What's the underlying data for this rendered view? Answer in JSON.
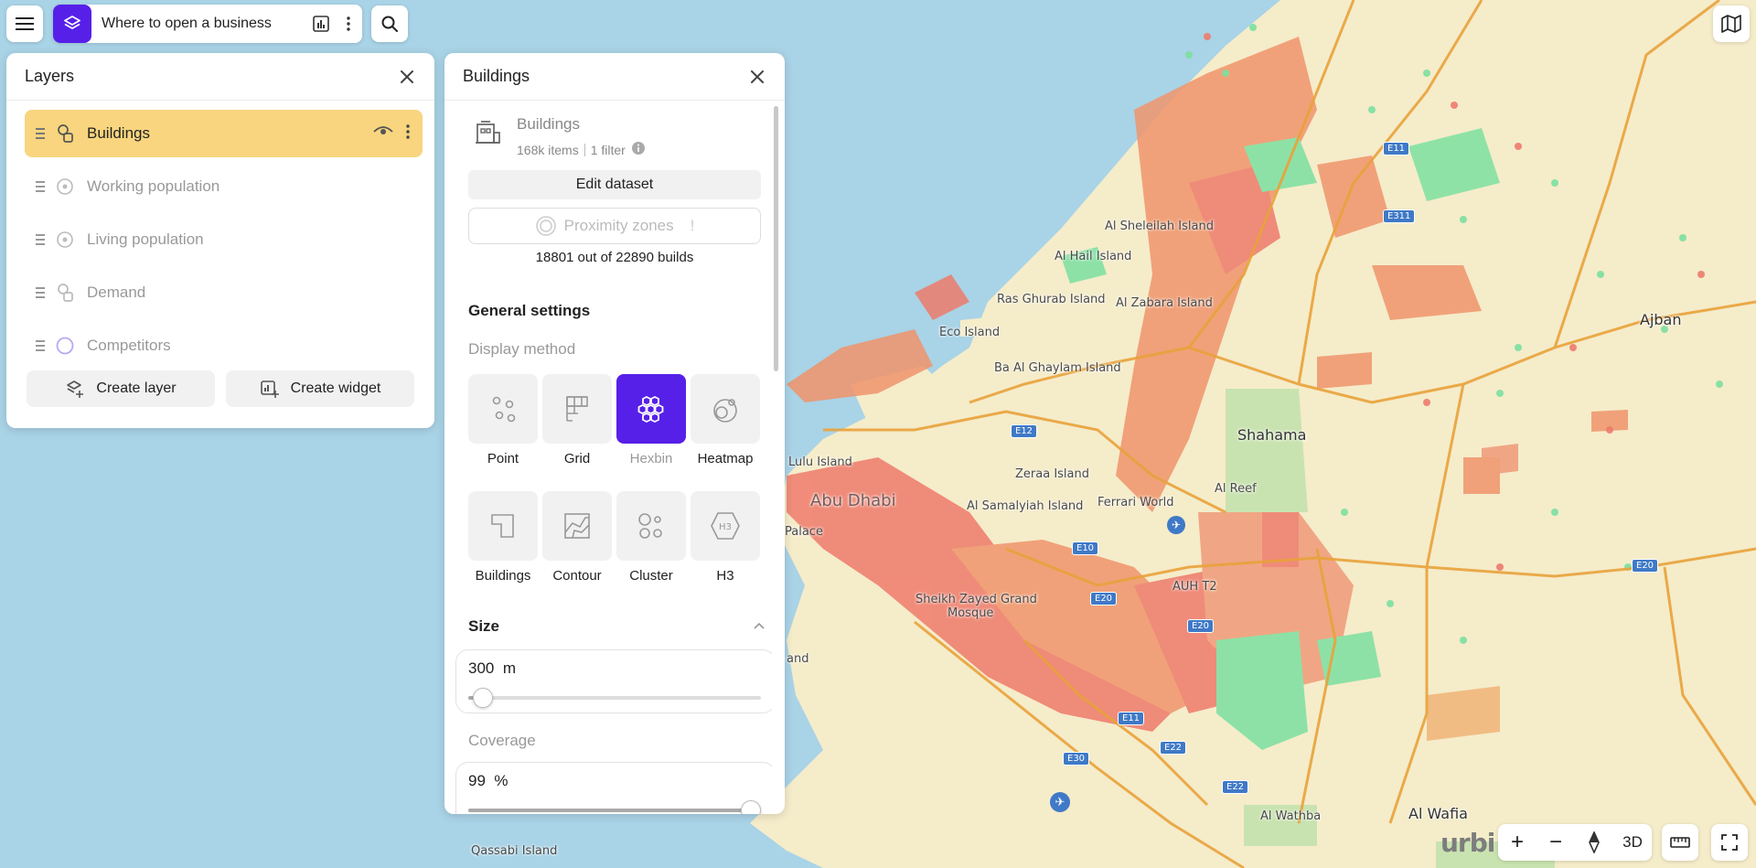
{
  "project": {
    "title": "Where to open a business"
  },
  "layers_panel": {
    "title": "Layers",
    "layers": [
      {
        "name": "Buildings",
        "active": true
      },
      {
        "name": "Working population",
        "active": false
      },
      {
        "name": "Living population",
        "active": false
      },
      {
        "name": "Demand",
        "active": false
      },
      {
        "name": "Competitors",
        "active": false
      }
    ],
    "create_layer_label": "Create layer",
    "create_widget_label": "Create widget"
  },
  "buildings_panel": {
    "title": "Buildings",
    "dataset_name": "Buildings",
    "items_count": "168k items",
    "filter_count": "1 filter",
    "edit_dataset_label": "Edit dataset",
    "proximity_zones_label": "Proximity zones",
    "proximity_zones_badge": "!",
    "builds_count": "18801 out of 22890 builds",
    "general_settings_title": "General settings",
    "display_method_title": "Display method",
    "methods": [
      {
        "label": "Point",
        "selected": false
      },
      {
        "label": "Grid",
        "selected": false
      },
      {
        "label": "Hexbin",
        "selected": true
      },
      {
        "label": "Heatmap",
        "selected": false
      },
      {
        "label": "Buildings",
        "selected": false
      },
      {
        "label": "Contour",
        "selected": false
      },
      {
        "label": "Cluster",
        "selected": false
      },
      {
        "label": "H3",
        "selected": false
      }
    ],
    "size_title": "Size",
    "size_value": "300",
    "size_unit": "m",
    "size_fraction": 0.05,
    "coverage_title": "Coverage",
    "coverage_value": "99",
    "coverage_unit": "%",
    "coverage_fraction": 0.99
  },
  "map": {
    "labels": [
      "Al Sheleilah Island",
      "Al Hail Island",
      "Ras Ghurab Island",
      "Al Zabara Island",
      "Eco Island",
      "Ba Al Ghaylam Island",
      "Shahama",
      "Ajban",
      "Lulu Island",
      "Abu Dhabi",
      "Zeraa Island",
      "Al Reef",
      "Al Samalyiah Island",
      "Ferrari World",
      "Sheikh Zayed Grand",
      "Mosque",
      "AUH T2",
      "Al Wathba",
      "Al Wafia",
      "Qassabi Island",
      "Palace",
      "and"
    ],
    "road_shields": [
      "E11",
      "E311",
      "E12",
      "E10",
      "E20",
      "E20",
      "E11",
      "E30",
      "E22",
      "E22",
      "E20"
    ],
    "brand": "urbi"
  },
  "map_controls": {
    "zoom_in": "+",
    "zoom_out": "−",
    "three_d": "3D"
  },
  "colors": {
    "accent": "#5620e8",
    "active_layer": "#f8d57e",
    "hex_high": "#ee7b6b",
    "hex_low": "#7ce0a0"
  }
}
